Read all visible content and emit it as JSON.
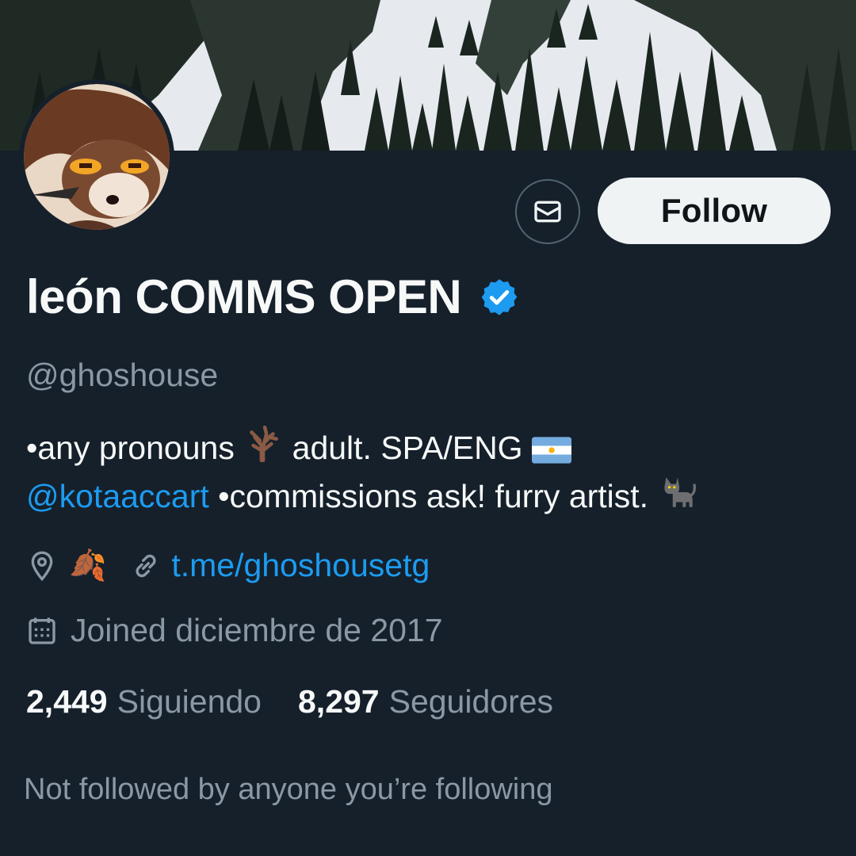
{
  "profile": {
    "display_name": "león COMMS OPEN",
    "handle": "@ghoshouse",
    "verified_icon": "verified-badge-icon",
    "bio": {
      "line1_a": "•any pronouns",
      "line1_b": "adult. SPA/ENG",
      "mention": "@kotaaccart",
      "line2_b": "•commissions ask! furry artist."
    },
    "location_icon": "location-pin-icon",
    "location_emoji": "🍂",
    "link_icon": "link-icon",
    "website": "t.me/ghoshousetg",
    "calendar_icon": "calendar-icon",
    "joined": "Joined diciembre de 2017"
  },
  "actions": {
    "message_icon": "envelope-icon",
    "follow_label": "Follow"
  },
  "stats": {
    "following_count": "2,449",
    "following_label": "Siguiendo",
    "followers_count": "8,297",
    "followers_label": "Seguidores"
  },
  "footer": {
    "not_followed": "Not followed by anyone you’re following"
  },
  "colors": {
    "background": "#15202b",
    "accent": "#1d9bf0",
    "secondary_text": "#8b98a5",
    "follow_button_bg": "#eff3f4"
  }
}
